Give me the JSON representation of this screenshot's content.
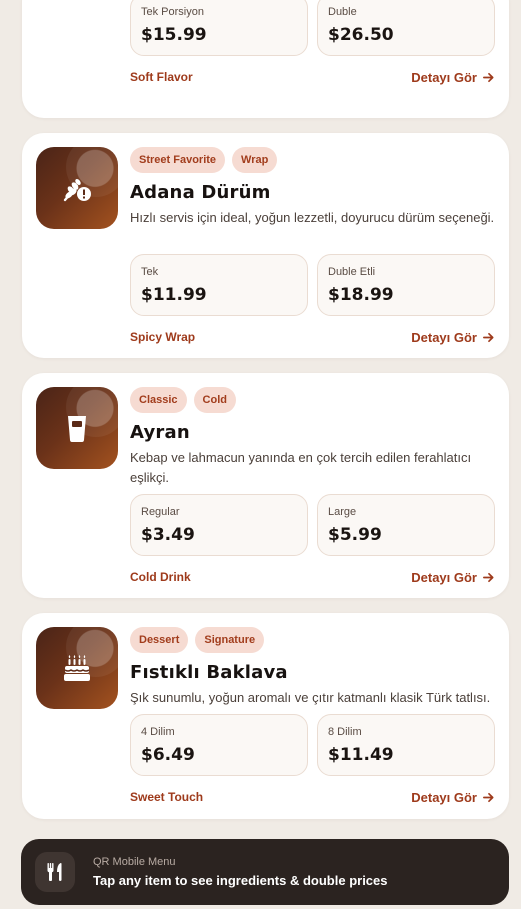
{
  "colors": {
    "accent": "#9e3a1b",
    "tag_bg": "#f6dbd2",
    "card_bg": "#ffffff",
    "page_bg": "#f0ebe5",
    "banner_bg": "#2b2320"
  },
  "items": [
    {
      "tags": [],
      "title": "",
      "description": "",
      "prices": [
        {
          "label": "Tek Porsiyon",
          "value": "$15.99"
        },
        {
          "label": "Duble",
          "value": "$26.50"
        }
      ],
      "note": "Soft Flavor",
      "detail_label": "Detayı Gör"
    },
    {
      "icon": "wheat-allergen-icon",
      "tags": [
        "Street Favorite",
        "Wrap"
      ],
      "title": "Adana Dürüm",
      "description": "Hızlı servis için ideal, yoğun lezzetli, doyurucu dürüm seçeneği.",
      "prices": [
        {
          "label": "Tek",
          "value": "$11.99"
        },
        {
          "label": "Duble Etli",
          "value": "$18.99"
        }
      ],
      "note": "Spicy Wrap",
      "detail_label": "Detayı Gör"
    },
    {
      "icon": "drink-glass-icon",
      "tags": [
        "Classic",
        "Cold"
      ],
      "title": "Ayran",
      "description": "Kebap ve lahmacun yanında en çok tercih edilen ferahlatıcı eşlikçi.",
      "prices": [
        {
          "label": "Regular",
          "value": "$3.49"
        },
        {
          "label": "Large",
          "value": "$5.99"
        }
      ],
      "note": "Cold Drink",
      "detail_label": "Detayı Gör"
    },
    {
      "icon": "cake-icon",
      "tags": [
        "Dessert",
        "Signature"
      ],
      "title": "Fıstıklı Baklava",
      "description": "Şık sunumlu, yoğun aromalı ve çıtır katmanlı klasik Türk tatlısı.",
      "prices": [
        {
          "label": "4 Dilim",
          "value": "$6.49"
        },
        {
          "label": "8 Dilim",
          "value": "$11.49"
        }
      ],
      "note": "Sweet Touch",
      "detail_label": "Detayı Gör"
    }
  ],
  "banner": {
    "icon": "utensils-icon",
    "subtitle": "QR Mobile Menu",
    "message": "Tap any item to see ingredients & double prices"
  }
}
